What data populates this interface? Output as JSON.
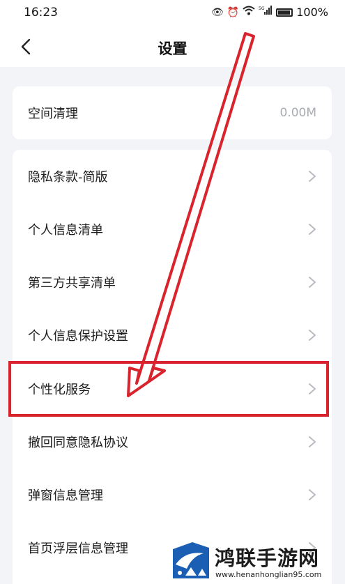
{
  "status_bar": {
    "time": "16:23",
    "signal_label": "5G",
    "battery": "100%",
    "icons": [
      "eye-icon",
      "alarm-icon",
      "wifi-icon",
      "signal-icon",
      "battery-icon"
    ]
  },
  "header": {
    "title": "设置"
  },
  "storage": {
    "label": "空间清理",
    "value": "0.00M"
  },
  "menu": {
    "items": [
      {
        "label": "隐私条款-简版"
      },
      {
        "label": "个人信息清单"
      },
      {
        "label": "第三方共享清单"
      },
      {
        "label": "个人信息保护设置"
      },
      {
        "label": "个性化服务"
      },
      {
        "label": "撤回同意隐私协议"
      },
      {
        "label": "弹窗信息管理"
      },
      {
        "label": "首页浮层信息管理"
      }
    ]
  },
  "annotation": {
    "highlighted_item": "个性化服务",
    "color": "#d9232d"
  },
  "watermark": {
    "title": "鸿联手游网",
    "url": "www.henanhonglian95.com"
  },
  "colors": {
    "background": "#f2f4f7",
    "card": "#ffffff",
    "accent_red": "#d9232d",
    "muted_text": "#a9acb3"
  }
}
